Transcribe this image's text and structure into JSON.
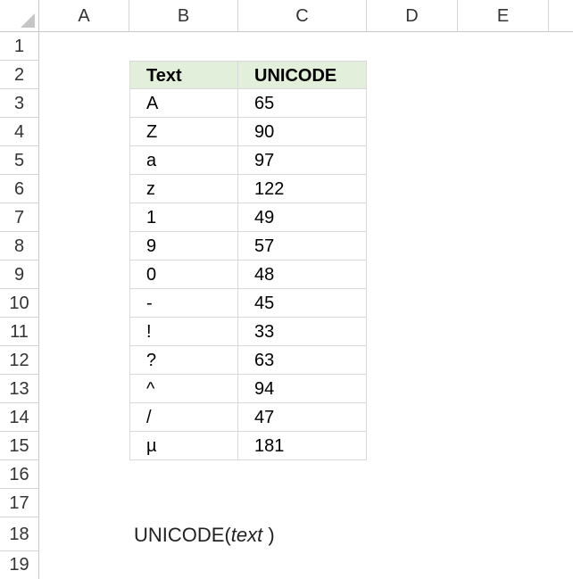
{
  "columns": [
    "A",
    "B",
    "C",
    "D",
    "E"
  ],
  "rows": [
    "1",
    "2",
    "3",
    "4",
    "5",
    "6",
    "7",
    "8",
    "9",
    "10",
    "11",
    "12",
    "13",
    "14",
    "15",
    "16",
    "17",
    "18",
    "19"
  ],
  "table": {
    "headers": [
      "Text",
      "UNICODE"
    ],
    "rows": [
      [
        "A",
        "65"
      ],
      [
        "Z",
        "90"
      ],
      [
        "a",
        "97"
      ],
      [
        "z",
        "122"
      ],
      [
        "1",
        "49"
      ],
      [
        "9",
        "57"
      ],
      [
        "0",
        "48"
      ],
      [
        "-",
        "45"
      ],
      [
        "!",
        "33"
      ],
      [
        "?",
        "63"
      ],
      [
        "^",
        "94"
      ],
      [
        "/",
        "47"
      ],
      [
        "µ",
        "181"
      ]
    ]
  },
  "formula": {
    "name": "UNICODE(",
    "arg": "text",
    "close": " )"
  },
  "colors": {
    "header_fill": "#e2efda",
    "grid": "#d9d9d9"
  }
}
